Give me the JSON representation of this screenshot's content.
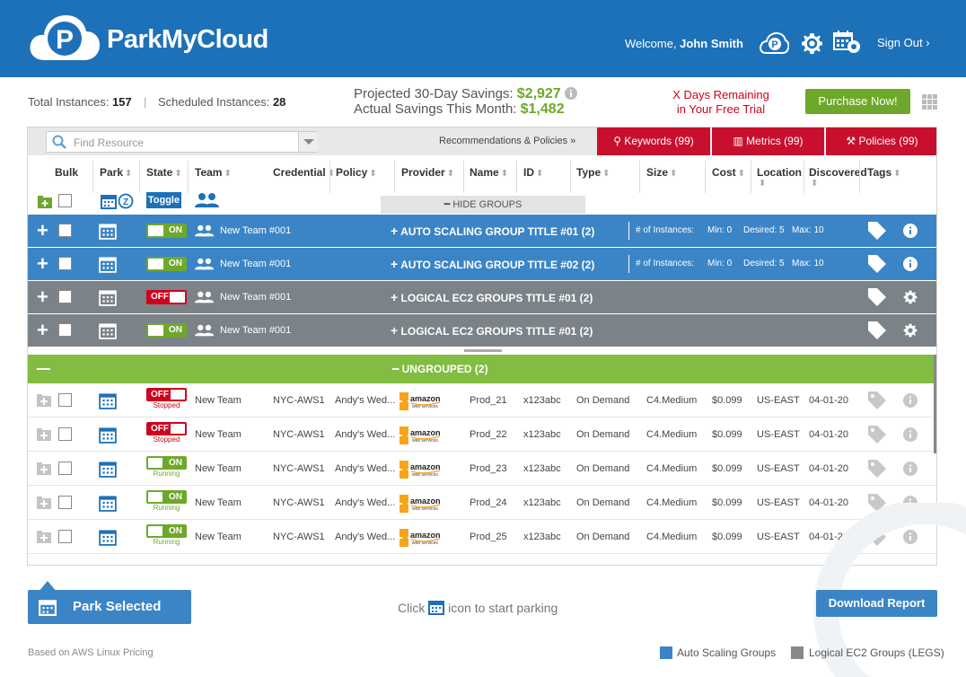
{
  "header": {
    "brand": "ParkMyCloud",
    "welcome_prefix": "Welcome, ",
    "user_name": "John Smith",
    "sign_out": "Sign Out",
    "icons": [
      "parkmycloud-logo-icon",
      "gear-icon",
      "calendar-gear-icon"
    ]
  },
  "summary": {
    "total_label": "Total Instances:",
    "total_value": "157",
    "sep": "|",
    "scheduled_label": "Scheduled Instances:",
    "scheduled_value": "28",
    "projected_label": "Projected 30-Day Savings:",
    "projected_value": "$2,927",
    "actual_label": "Actual Savings This Month:",
    "actual_value": "$1,482",
    "trial_line1": "X Days Remaining",
    "trial_line2": "in Your Free Trial",
    "purchase": "Purchase Now!"
  },
  "toolbar": {
    "search_placeholder": "Find Resource",
    "recommendations": "Recommendations & Policies »",
    "tabs": [
      {
        "label": "Keywords (99)",
        "icon": "search-icon"
      },
      {
        "label": "Metrics (99)",
        "icon": "bar-chart-icon"
      },
      {
        "label": "Policies (99)",
        "icon": "hammer-icon"
      }
    ]
  },
  "columns": {
    "bulk": "Bulk",
    "park": "Park",
    "state": "State",
    "team": "Team",
    "credential": "Credential",
    "policy": "Policy",
    "provider": "Provider",
    "name": "Name",
    "id": "ID",
    "type": "Type",
    "size": "Size",
    "cost": "Cost",
    "location": "Location",
    "discovered": "Discovered",
    "tags": "Tags",
    "toggle": "Toggle",
    "hide_groups": "HIDE GROUPS"
  },
  "groups": [
    {
      "color": "#3b85c6",
      "state": "ON",
      "team": "New Team #001",
      "title": "AUTO SCALING GROUP TITLE #01 (2)",
      "instances_label": "# of Instances:",
      "min": "Min: 0",
      "desired": "Desired: 5",
      "max": "Max: 10",
      "action_icon": "info-icon"
    },
    {
      "color": "#3b85c6",
      "state": "ON",
      "team": "New Team #001",
      "title": "AUTO SCALING GROUP TITLE #02 (2)",
      "instances_label": "# of Instances:",
      "min": "Min: 0",
      "desired": "Desired: 5",
      "max": "Max: 10",
      "action_icon": "info-icon"
    },
    {
      "color": "#7b8388",
      "state": "OFF",
      "team": "New Team #001",
      "title": "LOGICAL EC2 GROUPS TITLE #01 (2)",
      "action_icon": "gear-icon"
    },
    {
      "color": "#7b8388",
      "state": "ON",
      "team": "New Team #001",
      "title": "LOGICAL EC2 GROUPS TITLE #01 (2)",
      "action_icon": "gear-icon"
    }
  ],
  "ungrouped": {
    "label": "UNGROUPED (2)"
  },
  "rows": [
    {
      "state": "OFF",
      "status": "Stopped",
      "team": "New Team",
      "credential": "NYC-AWS1",
      "policy": "Andy's Wed...",
      "provider": "amazon",
      "name": "Prod_21",
      "id": "x123abc",
      "type": "On Demand",
      "size": "C4.Medium",
      "cost": "$0.099",
      "location": "US-EAST",
      "discovered": "04-01-20"
    },
    {
      "state": "OFF",
      "status": "Stopped",
      "team": "New Team",
      "credential": "NYC-AWS1",
      "policy": "Andy's Wed...",
      "provider": "amazon",
      "name": "Prod_22",
      "id": "x123abc",
      "type": "On Demand",
      "size": "C4.Medium",
      "cost": "$0.099",
      "location": "US-EAST",
      "discovered": "04-01-20"
    },
    {
      "state": "ON",
      "status": "Running",
      "team": "New Team",
      "credential": "NYC-AWS1",
      "policy": "Andy's Wed...",
      "provider": "amazon",
      "name": "Prod_23",
      "id": "x123abc",
      "type": "On Demand",
      "size": "C4.Medium",
      "cost": "$0.099",
      "location": "US-EAST",
      "discovered": "04-01-20"
    },
    {
      "state": "ON",
      "status": "Running",
      "team": "New Team",
      "credential": "NYC-AWS1",
      "policy": "Andy's Wed...",
      "provider": "amazon",
      "name": "Prod_24",
      "id": "x123abc",
      "type": "On Demand",
      "size": "C4.Medium",
      "cost": "$0.099",
      "location": "US-EAST",
      "discovered": "04-01-20"
    },
    {
      "state": "ON",
      "status": "Running",
      "team": "New Team",
      "credential": "NYC-AWS1",
      "policy": "Andy's Wed...",
      "provider": "amazon",
      "name": "Prod_25",
      "id": "x123abc",
      "type": "On Demand",
      "size": "C4.Medium",
      "cost": "$0.099",
      "location": "US-EAST",
      "discovered": "04-01-20"
    }
  ],
  "amazon_logo": {
    "word": "amazon",
    "sub": "web services"
  },
  "footer": {
    "park_selected": "Park Selected",
    "hint_before": "Click",
    "hint_after": "icon to start parking",
    "download": "Download Report",
    "pricing": "Based on AWS Linux Pricing",
    "legend": [
      {
        "label": "Auto Scaling Groups",
        "color": "#3b85c6"
      },
      {
        "label": "Logical EC2 Groups (LEGS)",
        "color": "#888888"
      }
    ]
  },
  "colors": {
    "brand_blue": "#1d71b8",
    "accent_green": "#6ea82b",
    "alert_red": "#c8102e"
  }
}
